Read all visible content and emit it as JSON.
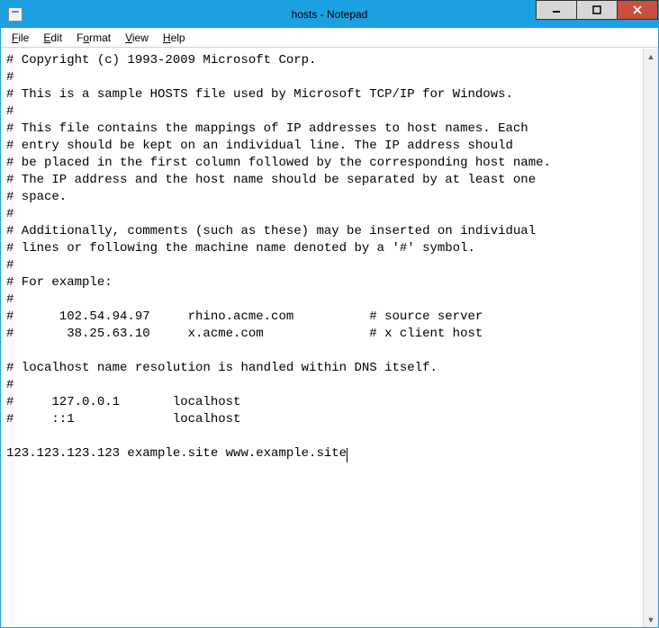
{
  "window": {
    "title": "hosts - Notepad"
  },
  "menu": {
    "file": "File",
    "edit": "Edit",
    "format": "Format",
    "view": "View",
    "help": "Help"
  },
  "editor": {
    "lines": [
      "# Copyright (c) 1993-2009 Microsoft Corp.",
      "#",
      "# This is a sample HOSTS file used by Microsoft TCP/IP for Windows.",
      "#",
      "# This file contains the mappings of IP addresses to host names. Each",
      "# entry should be kept on an individual line. The IP address should",
      "# be placed in the first column followed by the corresponding host name.",
      "# The IP address and the host name should be separated by at least one",
      "# space.",
      "#",
      "# Additionally, comments (such as these) may be inserted on individual",
      "# lines or following the machine name denoted by a '#' symbol.",
      "#",
      "# For example:",
      "#",
      "#      102.54.94.97     rhino.acme.com          # source server",
      "#       38.25.63.10     x.acme.com              # x client host",
      "",
      "# localhost name resolution is handled within DNS itself.",
      "#",
      "#     127.0.0.1       localhost",
      "#     ::1             localhost",
      "",
      "123.123.123.123 example.site www.example.site"
    ]
  },
  "scroll": {
    "up": "▲",
    "down": "▼"
  }
}
